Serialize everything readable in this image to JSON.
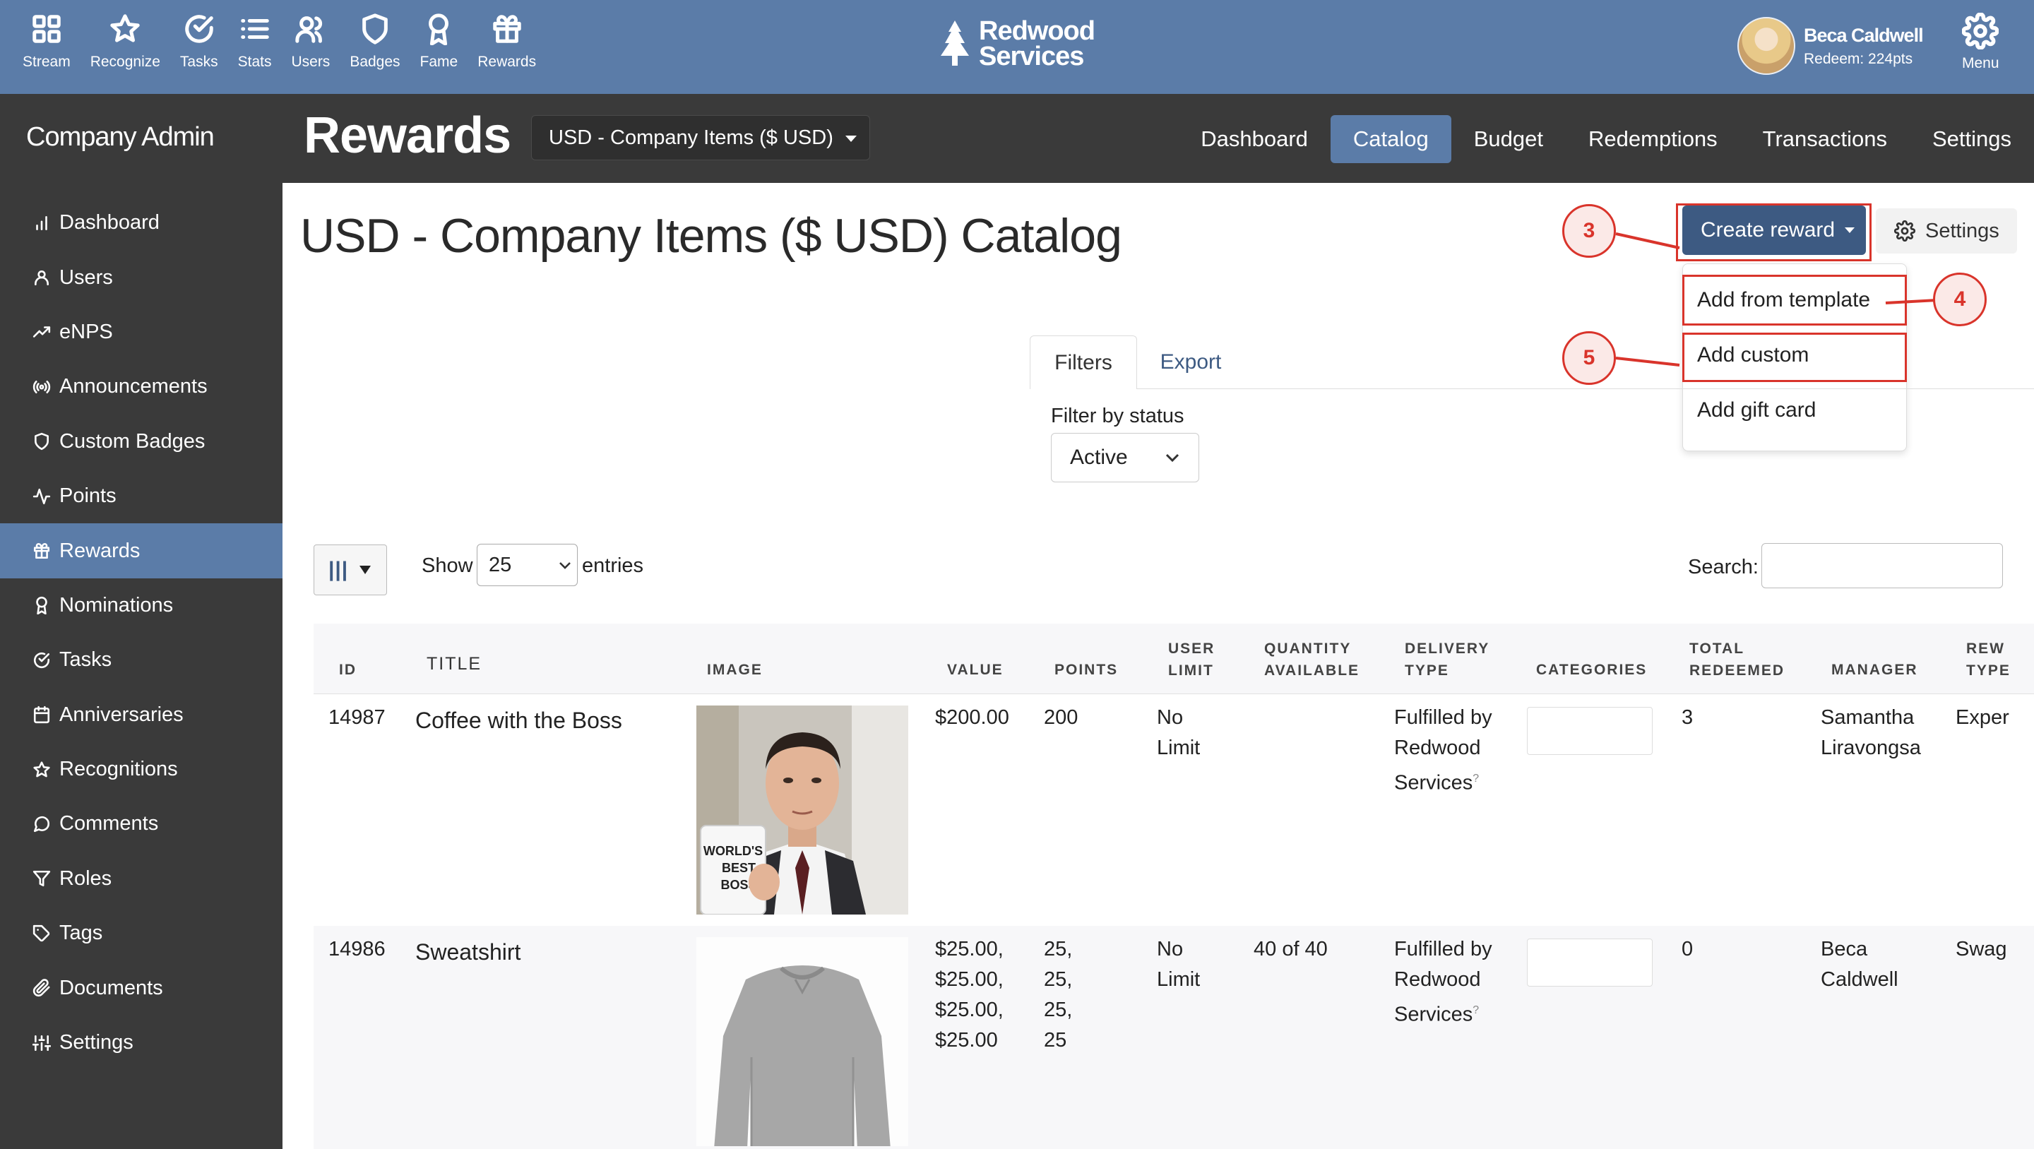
{
  "topnav": [
    {
      "label": "Stream",
      "icon": "grid-icon"
    },
    {
      "label": "Recognize",
      "icon": "star-icon"
    },
    {
      "label": "Tasks",
      "icon": "check-circle-icon"
    },
    {
      "label": "Stats",
      "icon": "list-icon"
    },
    {
      "label": "Users",
      "icon": "users-icon"
    },
    {
      "label": "Badges",
      "icon": "shield-icon"
    },
    {
      "label": "Fame",
      "icon": "award-icon"
    },
    {
      "label": "Rewards",
      "icon": "gift-icon"
    }
  ],
  "brand": {
    "line1": "Redwood",
    "line2": "Services"
  },
  "user": {
    "name": "Beca Caldwell",
    "points": "Redeem: 224pts"
  },
  "menu_label": "Menu",
  "sidebar": {
    "title": "Company Admin",
    "items": [
      {
        "label": "Dashboard",
        "icon": "bar-chart-icon"
      },
      {
        "label": "Users",
        "icon": "user-icon"
      },
      {
        "label": "eNPS",
        "icon": "trending-up-icon"
      },
      {
        "label": "Announcements",
        "icon": "broadcast-icon"
      },
      {
        "label": "Custom Badges",
        "icon": "shield-icon"
      },
      {
        "label": "Points",
        "icon": "activity-icon"
      },
      {
        "label": "Rewards",
        "icon": "gift-icon",
        "active": true
      },
      {
        "label": "Nominations",
        "icon": "award-icon"
      },
      {
        "label": "Tasks",
        "icon": "check-circle-icon"
      },
      {
        "label": "Anniversaries",
        "icon": "calendar-icon"
      },
      {
        "label": "Recognitions",
        "icon": "star-icon"
      },
      {
        "label": "Comments",
        "icon": "comment-icon"
      },
      {
        "label": "Roles",
        "icon": "filter-icon"
      },
      {
        "label": "Tags",
        "icon": "tag-icon"
      },
      {
        "label": "Documents",
        "icon": "paperclip-icon"
      },
      {
        "label": "Settings",
        "icon": "sliders-icon"
      }
    ]
  },
  "header": {
    "title": "Rewards",
    "catalog_select": "USD - Company Items ($ USD)",
    "tabs": [
      {
        "label": "Dashboard"
      },
      {
        "label": "Catalog",
        "active": true
      },
      {
        "label": "Budget"
      },
      {
        "label": "Redemptions"
      },
      {
        "label": "Transactions"
      },
      {
        "label": "Settings"
      }
    ]
  },
  "main": {
    "heading": "USD - Company Items ($ USD) Catalog",
    "create_reward": "Create reward",
    "settings": "Settings",
    "dropdown": [
      "Add from template",
      "Add custom",
      "Add gift card"
    ],
    "callouts": [
      "3",
      "4",
      "5"
    ],
    "filter_tabs": [
      "Filters",
      "Export"
    ],
    "filter_label": "Filter by status",
    "status_value": "Active",
    "show_label": "Show",
    "entries_value": "25",
    "entries_label": "entries",
    "search_label": "Search:"
  },
  "table": {
    "headers": [
      "ID",
      "TITLE",
      "IMAGE",
      "VALUE",
      "POINTS",
      "USER\nLIMIT",
      "QUANTITY\nAVAILABLE",
      "DELIVERY\nTYPE",
      "CATEGORIES",
      "TOTAL\nREDEEMED",
      "MANAGER",
      "REW\nTYPE"
    ],
    "rows": [
      {
        "id": "14987",
        "title": "Coffee with the Boss",
        "mug_text": "WORLD'S\nBEST\nBOSS",
        "value": "$200.00",
        "points": "200",
        "user_limit": "No\nLimit",
        "quantity": "",
        "delivery": "Fulfilled by\nRedwood\nServices",
        "total_redeemed": "3",
        "manager": "Samantha\nLiravongsa",
        "type": "Exper"
      },
      {
        "id": "14986",
        "title": "Sweatshirt",
        "value": "$25.00,\n$25.00,\n$25.00,\n$25.00",
        "points": "25,\n25,\n25,\n25",
        "user_limit": "No\nLimit",
        "quantity": "40 of 40",
        "delivery": "Fulfilled by\nRedwood\nServices",
        "total_redeemed": "0",
        "manager": "Beca\nCaldwell",
        "type": "Swag"
      }
    ]
  }
}
